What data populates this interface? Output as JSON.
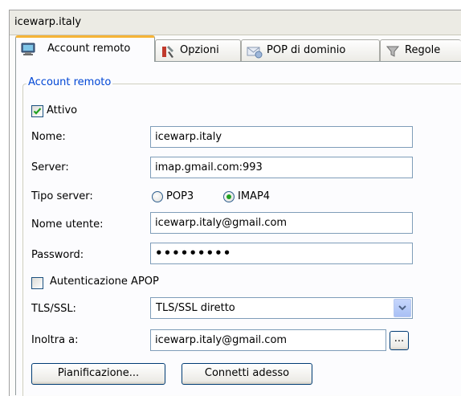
{
  "window": {
    "title": "icewarp.italy"
  },
  "tabs": [
    {
      "label": "Account remoto",
      "icon": "monitor-icon",
      "active": true
    },
    {
      "label": "Opzioni",
      "icon": "tools-icon",
      "active": false
    },
    {
      "label": "POP di dominio",
      "icon": "mail-envelope-icon",
      "active": false
    },
    {
      "label": "Regole",
      "icon": "filter-funnel-icon",
      "active": false
    }
  ],
  "group": {
    "legend": "Account remoto"
  },
  "form": {
    "attivo": {
      "label": "Attivo",
      "checked": true
    },
    "nome": {
      "label": "Nome:",
      "value": "icewarp.italy"
    },
    "server": {
      "label": "Server:",
      "value": "imap.gmail.com:993"
    },
    "tipo_server": {
      "label": "Tipo server:",
      "options": [
        "POP3",
        "IMAP4"
      ],
      "selected": "IMAP4"
    },
    "nome_utente": {
      "label": "Nome utente:",
      "value": "icewarp.italy@gmail.com"
    },
    "password": {
      "label": "Password:",
      "value": "•••••••••"
    },
    "apop": {
      "label": "Autenticazione APOP",
      "checked": false
    },
    "tls_ssl": {
      "label": "TLS/SSL:",
      "value": "TLS/SSL diretto"
    },
    "inoltra": {
      "label": "Inoltra a:",
      "value": "icewarp.italy@gmail.com",
      "browse_label": "..."
    }
  },
  "buttons": {
    "schedule": "Pianificazione...",
    "connect": "Connetti adesso"
  },
  "colors": {
    "active_tab_accent": "#f5b437",
    "group_legend": "#0046d5",
    "check_mark": "#21a121"
  }
}
